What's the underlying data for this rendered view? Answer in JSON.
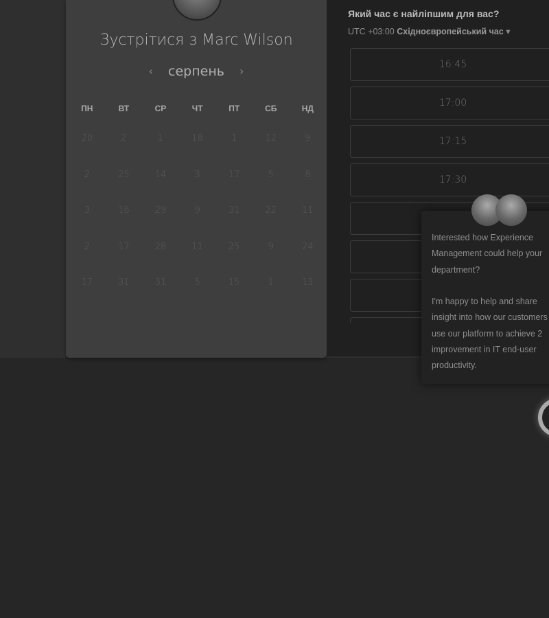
{
  "scheduler": {
    "title": "Зустрітися з Marc Wilson",
    "month": "серпень",
    "prev_icon": "‹",
    "next_icon": "›",
    "weekdays": [
      "ПН",
      "ВТ",
      "СР",
      "ЧТ",
      "ПТ",
      "СБ",
      "НД"
    ],
    "days": [
      [
        "20",
        "2",
        "1",
        "18",
        "1",
        "12",
        "9"
      ],
      [
        "2",
        "25",
        "14",
        "3",
        "17",
        "5",
        "8"
      ],
      [
        "3",
        "16",
        "29",
        "9",
        "31",
        "22",
        "11"
      ],
      [
        "2",
        "17",
        "28",
        "11",
        "25",
        "9",
        "24"
      ],
      [
        "17",
        "31",
        "31",
        "5",
        "15",
        "1",
        "13"
      ]
    ]
  },
  "times": {
    "question": "Який час є найліпшим для вас?",
    "tz_offset": "UTC +03:00",
    "tz_name": "Східноєвропейський час",
    "slots": [
      "16:45",
      "17:00",
      "17:15",
      "17:30",
      "",
      "",
      "",
      ""
    ]
  },
  "chat": {
    "lines": [
      "Interested how Experience",
      "Management could help your",
      "department?",
      "",
      "I'm happy to help and share",
      "insight into how our customers",
      "use our platform to achieve 2",
      "improvement in IT end-user",
      "productivity."
    ]
  }
}
